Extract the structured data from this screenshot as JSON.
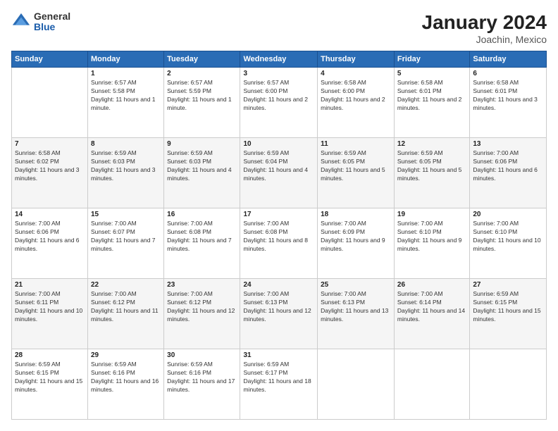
{
  "header": {
    "logo_general": "General",
    "logo_blue": "Blue",
    "month_title": "January 2024",
    "location": "Joachin, Mexico"
  },
  "weekdays": [
    "Sunday",
    "Monday",
    "Tuesday",
    "Wednesday",
    "Thursday",
    "Friday",
    "Saturday"
  ],
  "weeks": [
    [
      null,
      {
        "num": "1",
        "sunrise": "6:57 AM",
        "sunset": "5:58 PM",
        "daylight": "11 hours and 1 minute."
      },
      {
        "num": "2",
        "sunrise": "6:57 AM",
        "sunset": "5:59 PM",
        "daylight": "11 hours and 1 minute."
      },
      {
        "num": "3",
        "sunrise": "6:57 AM",
        "sunset": "6:00 PM",
        "daylight": "11 hours and 2 minutes."
      },
      {
        "num": "4",
        "sunrise": "6:58 AM",
        "sunset": "6:00 PM",
        "daylight": "11 hours and 2 minutes."
      },
      {
        "num": "5",
        "sunrise": "6:58 AM",
        "sunset": "6:01 PM",
        "daylight": "11 hours and 2 minutes."
      },
      {
        "num": "6",
        "sunrise": "6:58 AM",
        "sunset": "6:01 PM",
        "daylight": "11 hours and 3 minutes."
      }
    ],
    [
      {
        "num": "7",
        "sunrise": "6:58 AM",
        "sunset": "6:02 PM",
        "daylight": "11 hours and 3 minutes."
      },
      {
        "num": "8",
        "sunrise": "6:59 AM",
        "sunset": "6:03 PM",
        "daylight": "11 hours and 3 minutes."
      },
      {
        "num": "9",
        "sunrise": "6:59 AM",
        "sunset": "6:03 PM",
        "daylight": "11 hours and 4 minutes."
      },
      {
        "num": "10",
        "sunrise": "6:59 AM",
        "sunset": "6:04 PM",
        "daylight": "11 hours and 4 minutes."
      },
      {
        "num": "11",
        "sunrise": "6:59 AM",
        "sunset": "6:05 PM",
        "daylight": "11 hours and 5 minutes."
      },
      {
        "num": "12",
        "sunrise": "6:59 AM",
        "sunset": "6:05 PM",
        "daylight": "11 hours and 5 minutes."
      },
      {
        "num": "13",
        "sunrise": "7:00 AM",
        "sunset": "6:06 PM",
        "daylight": "11 hours and 6 minutes."
      }
    ],
    [
      {
        "num": "14",
        "sunrise": "7:00 AM",
        "sunset": "6:06 PM",
        "daylight": "11 hours and 6 minutes."
      },
      {
        "num": "15",
        "sunrise": "7:00 AM",
        "sunset": "6:07 PM",
        "daylight": "11 hours and 7 minutes."
      },
      {
        "num": "16",
        "sunrise": "7:00 AM",
        "sunset": "6:08 PM",
        "daylight": "11 hours and 7 minutes."
      },
      {
        "num": "17",
        "sunrise": "7:00 AM",
        "sunset": "6:08 PM",
        "daylight": "11 hours and 8 minutes."
      },
      {
        "num": "18",
        "sunrise": "7:00 AM",
        "sunset": "6:09 PM",
        "daylight": "11 hours and 9 minutes."
      },
      {
        "num": "19",
        "sunrise": "7:00 AM",
        "sunset": "6:10 PM",
        "daylight": "11 hours and 9 minutes."
      },
      {
        "num": "20",
        "sunrise": "7:00 AM",
        "sunset": "6:10 PM",
        "daylight": "11 hours and 10 minutes."
      }
    ],
    [
      {
        "num": "21",
        "sunrise": "7:00 AM",
        "sunset": "6:11 PM",
        "daylight": "11 hours and 10 minutes."
      },
      {
        "num": "22",
        "sunrise": "7:00 AM",
        "sunset": "6:12 PM",
        "daylight": "11 hours and 11 minutes."
      },
      {
        "num": "23",
        "sunrise": "7:00 AM",
        "sunset": "6:12 PM",
        "daylight": "11 hours and 12 minutes."
      },
      {
        "num": "24",
        "sunrise": "7:00 AM",
        "sunset": "6:13 PM",
        "daylight": "11 hours and 12 minutes."
      },
      {
        "num": "25",
        "sunrise": "7:00 AM",
        "sunset": "6:13 PM",
        "daylight": "11 hours and 13 minutes."
      },
      {
        "num": "26",
        "sunrise": "7:00 AM",
        "sunset": "6:14 PM",
        "daylight": "11 hours and 14 minutes."
      },
      {
        "num": "27",
        "sunrise": "6:59 AM",
        "sunset": "6:15 PM",
        "daylight": "11 hours and 15 minutes."
      }
    ],
    [
      {
        "num": "28",
        "sunrise": "6:59 AM",
        "sunset": "6:15 PM",
        "daylight": "11 hours and 15 minutes."
      },
      {
        "num": "29",
        "sunrise": "6:59 AM",
        "sunset": "6:16 PM",
        "daylight": "11 hours and 16 minutes."
      },
      {
        "num": "30",
        "sunrise": "6:59 AM",
        "sunset": "6:16 PM",
        "daylight": "11 hours and 17 minutes."
      },
      {
        "num": "31",
        "sunrise": "6:59 AM",
        "sunset": "6:17 PM",
        "daylight": "11 hours and 18 minutes."
      },
      null,
      null,
      null
    ]
  ],
  "labels": {
    "sunrise_prefix": "Sunrise: ",
    "sunset_prefix": "Sunset: ",
    "daylight_prefix": "Daylight: "
  }
}
